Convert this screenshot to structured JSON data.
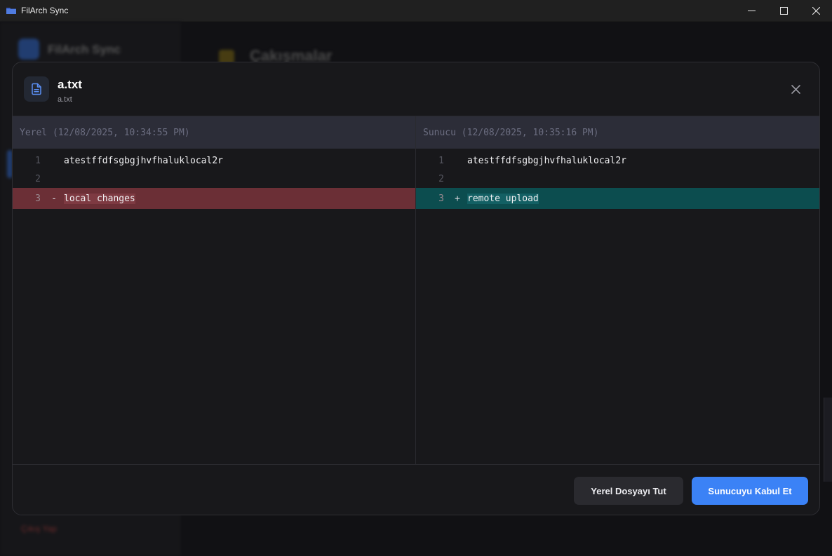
{
  "window": {
    "title": "FilArch Sync",
    "controls": {
      "minimize": "—",
      "maximize": "☐",
      "close": "✕"
    }
  },
  "background": {
    "app_name": "FilArch Sync",
    "heading": "Çakışmalar",
    "logout": "Çıkış Yap"
  },
  "modal": {
    "title": "a.txt",
    "subtitle": "a.txt",
    "left_pane": {
      "header": "Yerel (12/08/2025, 10:34:55 PM)",
      "lines": [
        {
          "num": "1",
          "marker": "",
          "text": "atestffdfsgbgjhvfhaluklocal2r"
        },
        {
          "num": "2",
          "marker": "",
          "text": ""
        },
        {
          "num": "3",
          "marker": "-",
          "text": "local changes"
        }
      ]
    },
    "right_pane": {
      "header": "Sunucu (12/08/2025, 10:35:16 PM)",
      "lines": [
        {
          "num": "1",
          "marker": "",
          "text": "atestffdfsgbgjhvfhaluklocal2r"
        },
        {
          "num": "2",
          "marker": "",
          "text": ""
        },
        {
          "num": "3",
          "marker": "+",
          "text": "remote upload"
        }
      ]
    },
    "buttons": {
      "keep_local": "Yerel Dosyayı Tut",
      "accept_server": "Sunucuyu Kabul Et"
    }
  },
  "colors": {
    "accent": "#3b82f6",
    "removed_line": "#6b2f36",
    "added_line": "#0c4d4f"
  }
}
